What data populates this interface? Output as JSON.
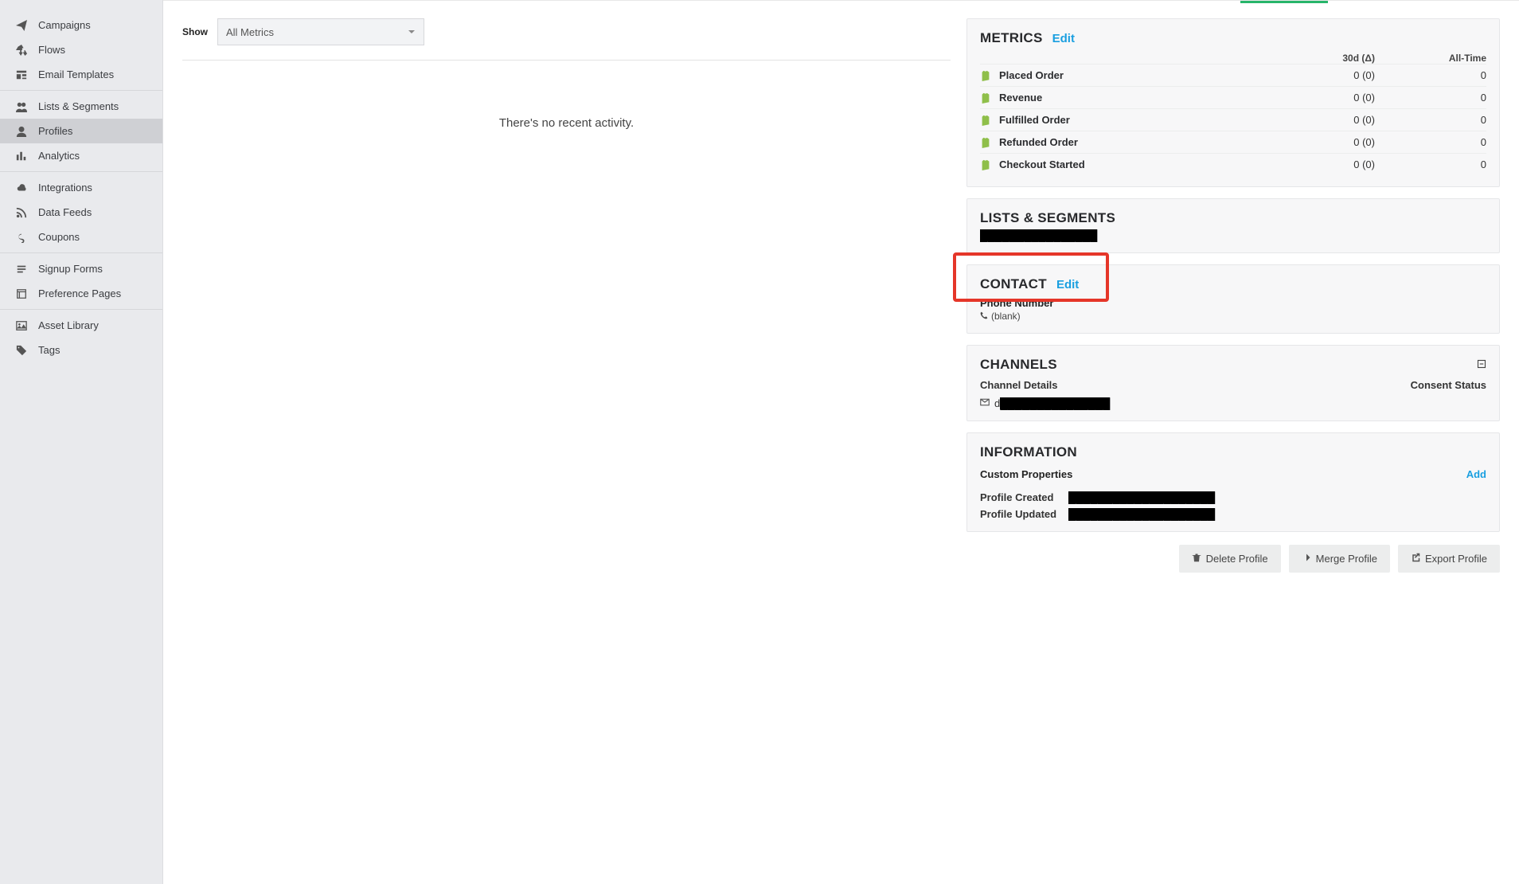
{
  "sidebar": {
    "groups": [
      {
        "items": [
          {
            "label": "Campaigns"
          },
          {
            "label": "Flows"
          },
          {
            "label": "Email Templates"
          }
        ]
      },
      {
        "items": [
          {
            "label": "Lists & Segments"
          },
          {
            "label": "Profiles"
          },
          {
            "label": "Analytics"
          }
        ]
      },
      {
        "items": [
          {
            "label": "Integrations"
          },
          {
            "label": "Data Feeds"
          },
          {
            "label": "Coupons"
          }
        ]
      },
      {
        "items": [
          {
            "label": "Signup Forms"
          },
          {
            "label": "Preference Pages"
          }
        ]
      },
      {
        "items": [
          {
            "label": "Asset Library"
          },
          {
            "label": "Tags"
          }
        ]
      }
    ]
  },
  "activity": {
    "show_label": "Show",
    "select_value": "All Metrics",
    "empty": "There's no recent activity."
  },
  "metrics": {
    "title": "METRICS",
    "edit": "Edit",
    "head_30d": "30d (Δ)",
    "head_all": "All-Time",
    "rows": [
      {
        "name": "Placed Order",
        "d30": "0 (0)",
        "all": "0"
      },
      {
        "name": "Revenue",
        "d30": "0 (0)",
        "all": "0"
      },
      {
        "name": "Fulfilled Order",
        "d30": "0 (0)",
        "all": "0"
      },
      {
        "name": "Refunded Order",
        "d30": "0 (0)",
        "all": "0"
      },
      {
        "name": "Checkout Started",
        "d30": "0 (0)",
        "all": "0"
      }
    ]
  },
  "lists": {
    "title": "LISTS & SEGMENTS",
    "redacted": "████████████████"
  },
  "contact": {
    "title": "CONTACT",
    "edit": "Edit",
    "phone_label": "Phone Number",
    "phone_value": "(blank)"
  },
  "channels": {
    "title": "CHANNELS",
    "details": "Channel Details",
    "consent": "Consent Status",
    "email_prefix": "d",
    "redacted": "███████████████"
  },
  "info": {
    "title": "INFORMATION",
    "custom_props": "Custom Properties",
    "add": "Add",
    "created_label": "Profile Created",
    "updated_label": "Profile Updated",
    "created_redacted": "████████████████████",
    "updated_redacted": "████████████████████"
  },
  "actions": {
    "delete": "Delete Profile",
    "merge": "Merge Profile",
    "export": "Export Profile"
  }
}
